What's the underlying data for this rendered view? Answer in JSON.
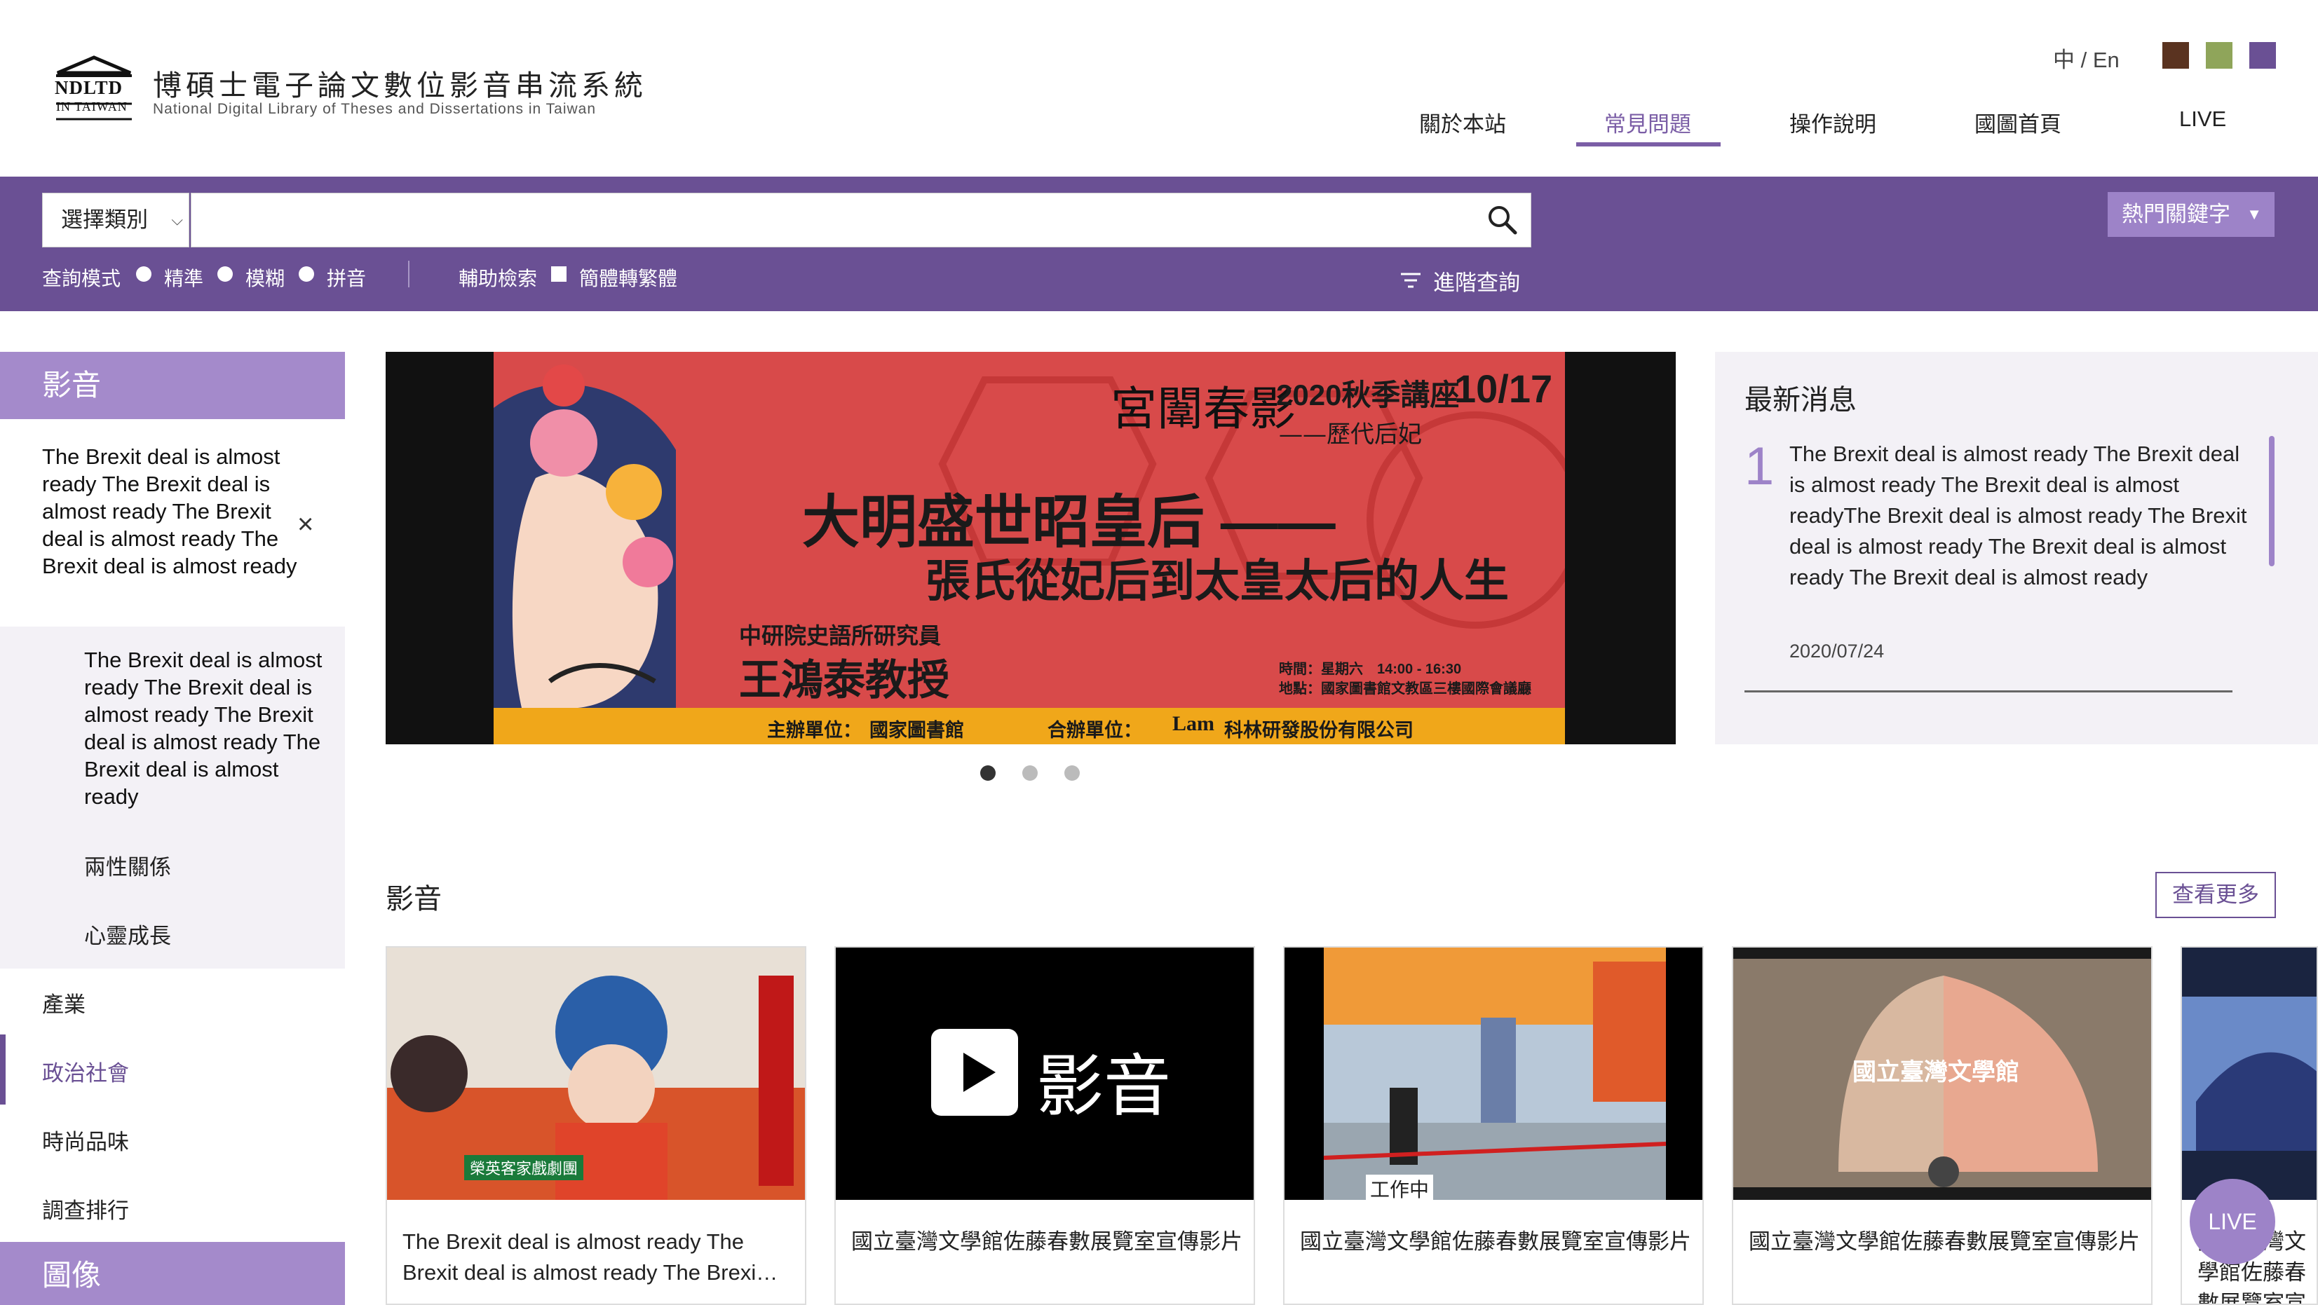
{
  "header": {
    "logo_ndltd": "NDLTD",
    "logo_taiwan": "IN TAIWAN",
    "site_title": "博碩士電子論文數位影音串流系統",
    "site_subtitle": "National Digital Library of Theses and Dissertations in Taiwan",
    "lang_zh": "中",
    "lang_sep": "/",
    "lang_en": "En",
    "theme_colors": [
      "#5a3320",
      "#8fa55a",
      "#6a5094"
    ],
    "nav": [
      "關於本站",
      "常見問題",
      "操作說明",
      "國圖首頁",
      "LIVE"
    ],
    "nav_active_index": 1
  },
  "search": {
    "category_label": "選擇類別",
    "query_value": "",
    "hot_keywords_label": "熱門關鍵字",
    "mode_label": "查詢模式",
    "modes": [
      "精準",
      "模糊",
      "拼音"
    ],
    "assist_label": "輔助檢索",
    "convert_label": "簡體轉繁體",
    "advanced_label": "進階查詢",
    "accent_color": "#6a5094"
  },
  "sidebar": {
    "section_video": "影音",
    "expanded_item": "The Brexit deal is almost ready The Brexit deal is almost ready The Brexit deal is almost ready The Brexit deal is almost ready",
    "sub_items": [
      "The Brexit deal is almost ready The Brexit deal is almost ready The Brexit deal is almost ready The Brexit deal is almost ready",
      "兩性關係",
      "心靈成長"
    ],
    "items": [
      "產業",
      "政治社會",
      "時尚品味",
      "調查排行"
    ],
    "selected_item": "政治社會",
    "section_image": "圖像"
  },
  "banner": {
    "brand_script": "宮闈春影",
    "series": "2020秋季講座",
    "date": "10/17",
    "signature": "——歷代后妃",
    "headline_1": "大明盛世昭皇后 ——",
    "headline_2": "張氏從妃后到太皇太后的人生",
    "speaker_org": "中研院史語所研究員",
    "speaker": "王鴻泰教授",
    "time_info": "時間：星期六　14:00 - 16:30",
    "place_info": "地點：國家圖書館文教區三樓國際會議廳",
    "host_label": "主辦單位：",
    "host": "國家圖書館",
    "cohost_label": "合辦單位：",
    "cohost_logo": "Lam",
    "cohost": "科林研發股份有限公司",
    "slides_total": 3,
    "active_slide": 0
  },
  "news": {
    "title": "最新消息",
    "items": [
      {
        "num": "1",
        "text": "The Brexit deal is almost ready The Brexit deal is almost ready The Brexit deal is almost readyThe Brexit deal is almost ready The Brexit deal is almost ready The Brexit deal is almost ready The Brexit deal is almost ready",
        "date": "2020/07/24"
      }
    ]
  },
  "videos": {
    "title": "影音",
    "more_label": "查看更多",
    "cards": [
      {
        "caption": "The Brexit deal is almost ready The Brexit deal is almost ready The Brexi…",
        "thumb": "opera-performers",
        "overlay": "榮英客家戲劇團"
      },
      {
        "caption": "國立臺灣文學館佐藤春數展覽室宣傳影片",
        "thumb": "play-placeholder",
        "overlay": "影音"
      },
      {
        "caption": "國立臺灣文學館佐藤春數展覽室宣傳影片",
        "thumb": "station-filming",
        "overlay": "工作中"
      },
      {
        "caption": "國立臺灣文學館佐藤春數展覽室宣傳影片",
        "thumb": "fan-logo",
        "overlay": "國立臺灣文學館"
      },
      {
        "caption": "國立臺灣文學館佐藤春數展覽室宣傳影片",
        "thumb": "blue-abstract",
        "overlay": ""
      }
    ]
  },
  "live_bubble": "LIVE"
}
